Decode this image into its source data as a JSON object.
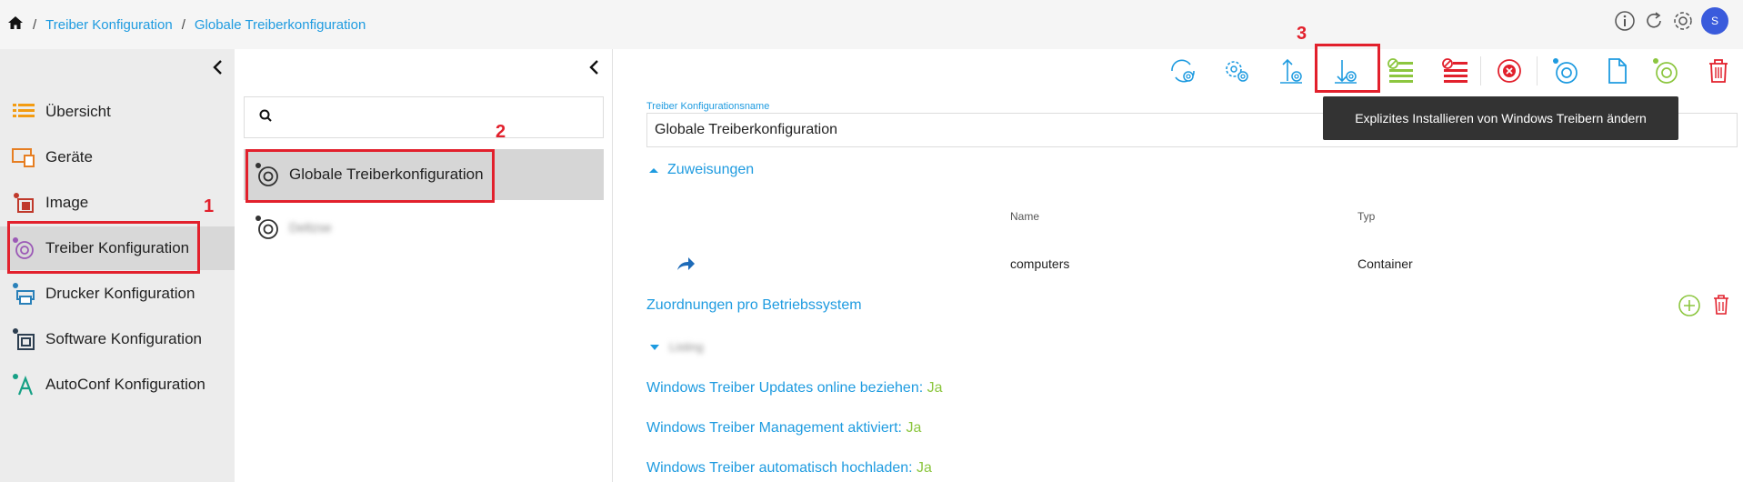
{
  "breadcrumb": {
    "home_icon": "home-icon",
    "sep": "/",
    "item1": "Treiber Konfiguration",
    "item2": "Globale Treiberkonfiguration"
  },
  "header": {
    "avatar_letter": "S",
    "icons": [
      "info-icon",
      "refresh-icon",
      "settings-icon"
    ]
  },
  "sidebar": {
    "items": [
      {
        "label": "Übersicht",
        "icon": "list-icon"
      },
      {
        "label": "Geräte",
        "icon": "devices-icon"
      },
      {
        "label": "Image",
        "icon": "image-icon"
      },
      {
        "label": "Treiber Konfiguration",
        "icon": "driver-icon"
      },
      {
        "label": "Drucker Konfiguration",
        "icon": "printer-icon"
      },
      {
        "label": "Software Konfiguration",
        "icon": "software-icon"
      },
      {
        "label": "AutoConf Konfiguration",
        "icon": "autoconf-icon"
      }
    ]
  },
  "list": {
    "search_placeholder": "",
    "items": [
      {
        "label": "Globale Treiberkonfiguration"
      },
      {
        "label": "Deltzse"
      }
    ]
  },
  "detail": {
    "name_label": "Treiber Konfigurationsname",
    "name_value": "Globale Treiberkonfiguration",
    "assignments_label": "Zuweisungen",
    "col_name": "Name",
    "col_type": "Typ",
    "row_name": "computers",
    "row_type": "Container",
    "os_mappings": "Zuordnungen pro Betriebssystem",
    "collapsed_section": "Listing",
    "setting1_key": "Windows Treiber Updates online beziehen:",
    "setting1_val": "Ja",
    "setting2_key": "Windows Treiber Management aktiviert:",
    "setting2_val": "Ja",
    "setting3_key": "Windows Treiber automatisch hochladen:",
    "setting3_val": "Ja"
  },
  "tooltip": "Explizites Installieren von Windows Treibern ändern",
  "annotations": {
    "n1": "1",
    "n2": "2",
    "n3": "3"
  },
  "colors": {
    "accent": "#1e9be0",
    "green": "#8cc63f",
    "red": "#e2202c"
  }
}
